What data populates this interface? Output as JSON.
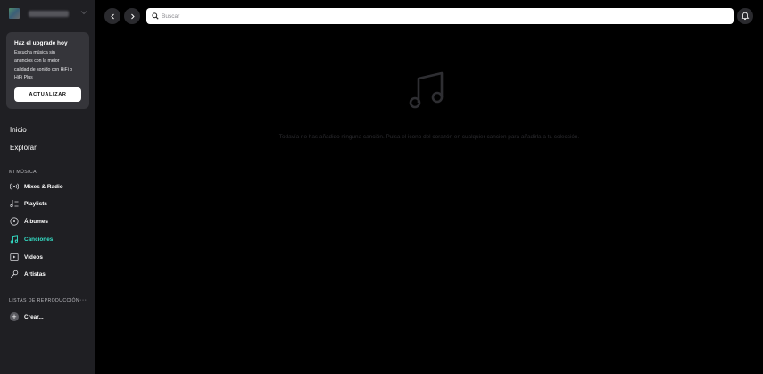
{
  "sidebar": {
    "upgrade": {
      "title": "Haz el upgrade hoy",
      "lines": [
        "Escucha música sin",
        "anuncios con la mejor",
        "calidad de sonido con HiFi o",
        "HiFi Plus"
      ],
      "button": "ACTUALIZAR"
    },
    "nav": [
      {
        "label": "Inicio"
      },
      {
        "label": "Explorar"
      }
    ],
    "my_music_label": "MI MÚSICA",
    "my_music": [
      {
        "label": "Mixes & Radio",
        "icon": "radio-icon"
      },
      {
        "label": "Playlists",
        "icon": "playlist-icon"
      },
      {
        "label": "Álbumes",
        "icon": "album-icon"
      },
      {
        "label": "Canciones",
        "icon": "music-note-icon",
        "active": true
      },
      {
        "label": "Vídeos",
        "icon": "video-icon"
      },
      {
        "label": "Artistas",
        "icon": "microphone-icon"
      }
    ],
    "playlists_label": "LISTAS DE REPRODUCCIÓN",
    "playlists_more": "···",
    "create_label": "Crear..."
  },
  "topbar": {
    "search_placeholder": "Buscar"
  },
  "main": {
    "empty_message": "Todavía no has añadido ninguna canción. Pulsa el icono del corazón en cualquier canción para añadirla a tu colección."
  },
  "colors": {
    "accent": "#34e1c8",
    "sidebar_bg": "#1f1f23",
    "card_bg": "#35353a",
    "main_bg": "#000000"
  }
}
